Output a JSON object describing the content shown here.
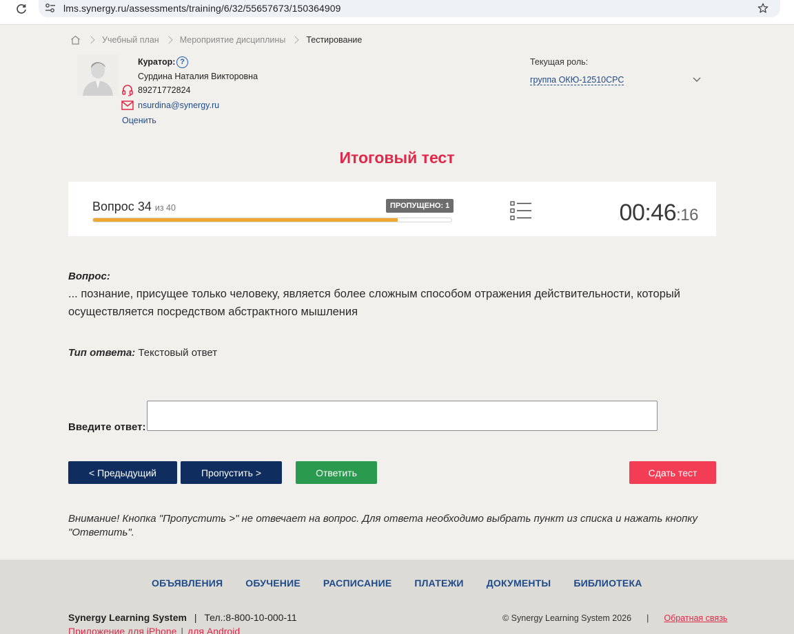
{
  "browser": {
    "url": "lms.synergy.ru/assessments/training/6/32/55657673/150364909"
  },
  "breadcrumb": {
    "items": [
      "Учебный план",
      "Мероприятие дисциплины"
    ],
    "current": "Тестирование"
  },
  "curator": {
    "title": "Куратор:",
    "help": "?",
    "name": "Сурдина Наталия Викторовна",
    "phone": "89271772824",
    "email": "nsurdina@synergy.ru",
    "rate_label": "Оценить"
  },
  "role": {
    "label": "Текущая роль:",
    "value": "группа ОКЮ-12510СРС"
  },
  "test": {
    "title": "Итоговый тест",
    "question_label": "Вопрос",
    "question_number": "34",
    "question_of": "из 40",
    "skipped_badge": "ПРОПУЩЕНО: 1",
    "progress_fraction": 0.85,
    "timer_main": "00:46",
    "timer_seconds": ":16"
  },
  "question": {
    "label": "Вопрос:",
    "text": "... познание, присущее только человеку, является более сложным способом отражения действительности, который осуществляется посредством абстрактного мышления",
    "answer_type_label": "Тип ответа:",
    "answer_type_value": "Текстовый ответ"
  },
  "answer": {
    "label": "Введите ответ:",
    "value": ""
  },
  "buttons": {
    "prev": "< Предыдущий",
    "skip": "Пропустить >",
    "answer": "Ответить",
    "submit": "Сдать тест"
  },
  "warning": "Внимание! Кнопка \"Пропустить >\" не отвечает на вопрос. Для ответа необходимо выбрать пункт из списка и нажать кнопку \"Ответить\".",
  "footer": {
    "nav": [
      "ОБЪЯВЛЕНИЯ",
      "ОБУЧЕНИЕ",
      "РАСПИСАНИЕ",
      "ПЛАТЕЖИ",
      "ДОКУМЕНТЫ",
      "БИБЛИОТЕКА"
    ],
    "brand": "Synergy Learning System",
    "phone": "Тел.:8-800-10-000-11",
    "app_iphone": "Приложение для iPhone",
    "app_android": "для Android",
    "copyright": "© Synergy Learning System 2026",
    "feedback": "Обратная связь"
  },
  "colors": {
    "accent_red": "#e0284a",
    "navy": "#0f2d5e",
    "green": "#2a9a4e",
    "progress": "#f0a830"
  }
}
